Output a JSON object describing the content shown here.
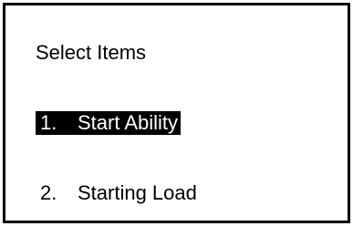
{
  "title": "Select Items",
  "menu": {
    "items": [
      {
        "number": "1.",
        "label": "Start Ability",
        "selected": true
      },
      {
        "number": "2.",
        "label": "Starting Load",
        "selected": false
      }
    ]
  },
  "colors": {
    "background": "#ffffff",
    "foreground": "#000000",
    "highlight_bg": "#000000",
    "highlight_fg": "#ffffff"
  }
}
